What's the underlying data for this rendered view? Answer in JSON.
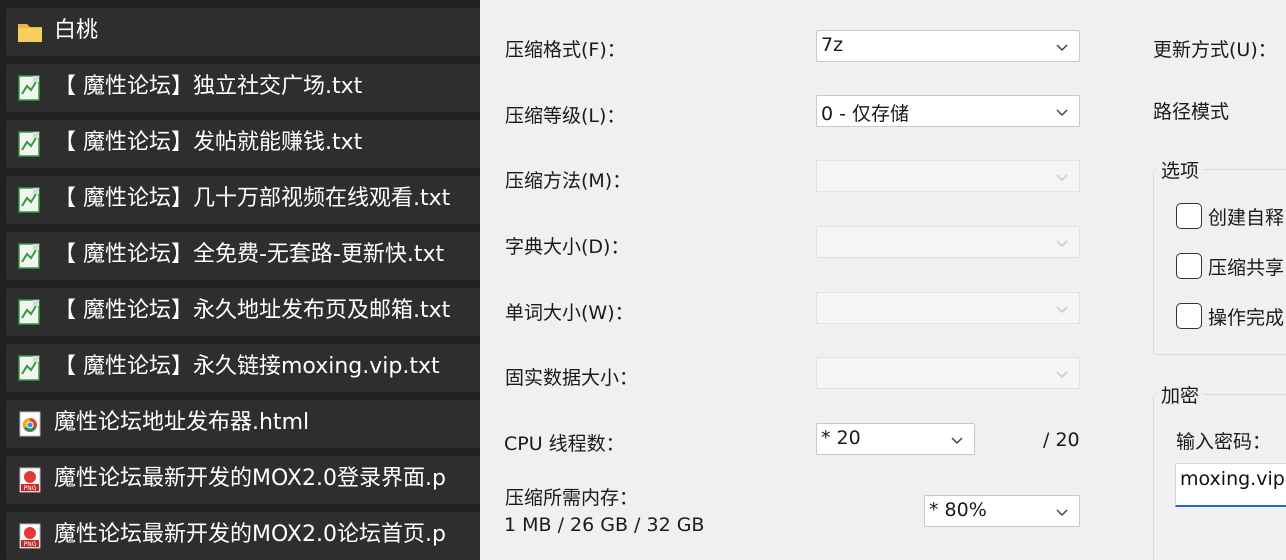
{
  "files": [
    {
      "name": "白桃",
      "icon": "folder-icon"
    },
    {
      "name": "【 魔性论坛】独立社交广场.txt",
      "icon": "text-file-icon"
    },
    {
      "name": "【 魔性论坛】发帖就能赚钱.txt",
      "icon": "text-file-icon"
    },
    {
      "name": "【 魔性论坛】几十万部视频在线观看.txt",
      "icon": "text-file-icon"
    },
    {
      "name": "【 魔性论坛】全免费-无套路-更新快.txt",
      "icon": "text-file-icon"
    },
    {
      "name": "【 魔性论坛】永久地址发布页及邮箱.txt",
      "icon": "text-file-icon"
    },
    {
      "name": "【 魔性论坛】永久链接moxing.vip.txt",
      "icon": "text-file-icon"
    },
    {
      "name": "魔性论坛地址发布器.html",
      "icon": "chrome-html-icon"
    },
    {
      "name": "魔性论坛最新开发的MOX2.0登录界面.p",
      "icon": "png-file-icon"
    },
    {
      "name": "魔性论坛最新开发的MOX2.0论坛首页.p",
      "icon": "png-file-icon"
    }
  ],
  "settings": {
    "format_label": "压缩格式(F)：",
    "format_value": "7z",
    "level_label": "压缩等级(L)：",
    "level_value": "0 - 仅存储",
    "method_label": "压缩方法(M)：",
    "method_value": "",
    "dict_label": "字典大小(D)：",
    "dict_value": "",
    "word_label": "单词大小(W)：",
    "word_value": "",
    "solid_label": "固实数据大小：",
    "solid_value": "",
    "threads_label": "CPU 线程数：",
    "threads_value": "*  20",
    "threads_max": "/ 20",
    "memory_label": "压缩所需内存：",
    "memory_detail": "1 MB / 26 GB / 32 GB",
    "memory_value": "*  80%"
  },
  "right": {
    "update_label": "更新方式(U)：",
    "path_label": "路径模式",
    "options_title": "选项",
    "options": [
      {
        "label": "创建自释",
        "checked": false
      },
      {
        "label": "压缩共享",
        "checked": false
      },
      {
        "label": "操作完成",
        "checked": false
      }
    ],
    "encrypt_title": "加密",
    "password_label": "输入密码：",
    "password_value": "moxing.vip"
  },
  "colors": {
    "list_bg": "#202020",
    "row_bg": "#2e2e2e",
    "dialog_bg": "#f0f0f0",
    "focus_accent": "#2a66c9"
  }
}
